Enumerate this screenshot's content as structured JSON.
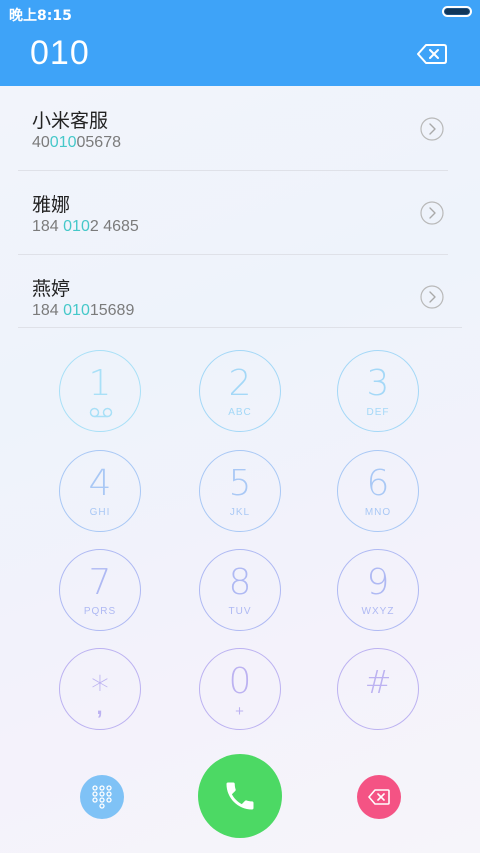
{
  "status_bar": {
    "time": "晚上8:15"
  },
  "header": {
    "dialed_number": "010"
  },
  "contacts": [
    {
      "name": "小米客服",
      "number_parts": [
        "40",
        "010",
        "05678"
      ]
    },
    {
      "name": "雅娜",
      "number_parts": [
        "184 ",
        "010",
        "2 4685"
      ]
    },
    {
      "name": "燕婷",
      "number_parts": [
        "184 ",
        "010",
        "15689"
      ]
    }
  ],
  "keypad": [
    {
      "digit": "1",
      "letters": ""
    },
    {
      "digit": "2",
      "letters": "ABC"
    },
    {
      "digit": "3",
      "letters": "DEF"
    },
    {
      "digit": "4",
      "letters": "GHI"
    },
    {
      "digit": "5",
      "letters": "JKL"
    },
    {
      "digit": "6",
      "letters": "MNO"
    },
    {
      "digit": "7",
      "letters": "PQRS"
    },
    {
      "digit": "8",
      "letters": "TUV"
    },
    {
      "digit": "9",
      "letters": "WXYZ"
    },
    {
      "digit": "*",
      "letters": ","
    },
    {
      "digit": "0",
      "letters": "+"
    },
    {
      "digit": "#",
      "letters": ""
    }
  ],
  "colors": {
    "header": "#3ea3f8",
    "highlight": "#45c8c9",
    "call_button": "#4cd964",
    "keypad_toggle": "#7fc2f6",
    "delete_button": "#f45384"
  },
  "icons": {
    "voicemail": "voicemail-icon",
    "backspace": "backspace-icon",
    "arrow": "chevron-right-circle-icon",
    "call": "phone-icon",
    "keypad_toggle": "keypad-grid-icon"
  }
}
